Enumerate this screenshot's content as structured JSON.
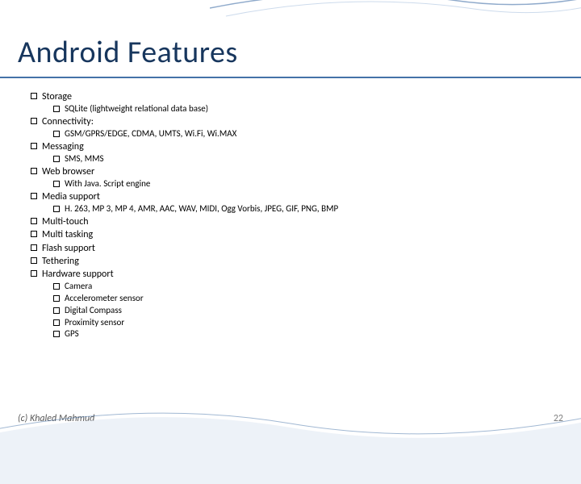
{
  "title": "Android Features",
  "bullets": [
    {
      "level": 1,
      "text": "Storage"
    },
    {
      "level": 2,
      "text": "SQLite (lightweight relational data base)"
    },
    {
      "level": 1,
      "text": "Connectivity:"
    },
    {
      "level": 2,
      "text": "GSM/GPRS/EDGE, CDMA, UMTS, Wi.Fi, Wi.MAX"
    },
    {
      "level": 1,
      "text": "Messaging"
    },
    {
      "level": 2,
      "text": "SMS, MMS"
    },
    {
      "level": 1,
      "text": "Web browser"
    },
    {
      "level": 2,
      "text": "With Java. Script engine"
    },
    {
      "level": 1,
      "text": "Media support"
    },
    {
      "level": 2,
      "text": "H. 263, MP 3, MP 4, AMR, AAC, WAV, MIDI, Ogg Vorbis, JPEG, GIF, PNG, BMP"
    },
    {
      "level": 1,
      "text": "Multi-touch"
    },
    {
      "level": 1,
      "text": "Multi tasking"
    },
    {
      "level": 1,
      "text": "Flash support"
    },
    {
      "level": 1,
      "text": "Tethering"
    },
    {
      "level": 1,
      "text": "Hardware support"
    },
    {
      "level": 2,
      "text": "Camera"
    },
    {
      "level": 2,
      "text": "Accelerometer sensor"
    },
    {
      "level": 2,
      "text": "Digital Compass"
    },
    {
      "level": 2,
      "text": "Proximity sensor"
    },
    {
      "level": 2,
      "text": "GPS"
    }
  ],
  "footer": "(c) Khaled Mahmud",
  "page": "22"
}
